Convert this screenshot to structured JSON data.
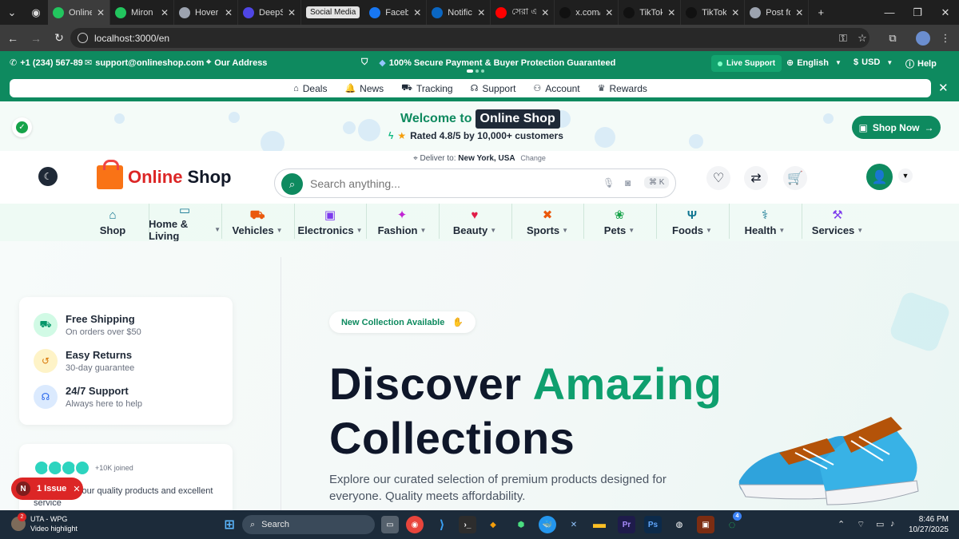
{
  "browser": {
    "tabs": [
      {
        "label": "Online",
        "color": "#22c55e",
        "active": true
      },
      {
        "label": "Miron",
        "color": "#22c55e"
      },
      {
        "label": "Hover",
        "color": "#9ca3af"
      },
      {
        "label": "DeepS",
        "color": "#4f46e5"
      },
      {
        "label": "Faceb",
        "color": "#1877f2"
      },
      {
        "label": "Notific",
        "color": "#0a66c2"
      },
      {
        "label": "সেরা এ",
        "color": "#ff0000"
      },
      {
        "label": "x.com/",
        "color": "#111111"
      },
      {
        "label": "TikTok",
        "color": "#111111"
      },
      {
        "label": "TikTok",
        "color": "#111111"
      },
      {
        "label": "Post fo",
        "color": "#9ca3af"
      }
    ],
    "tab_group": "Social Media",
    "url": "localhost:3000/en"
  },
  "topbar": {
    "phone": "+1 (234) 567-89",
    "email": "support@onlineshop.com",
    "address": "Our Address",
    "secure_msg": "100% Secure Payment & Buyer Protection Guaranteed",
    "live_support": "Live Support",
    "language": "English",
    "currency": "USD",
    "help": "Help"
  },
  "quicklinks": [
    "Deals",
    "News",
    "Tracking",
    "Support",
    "Account",
    "Rewards"
  ],
  "welcome": {
    "prefix": "Welcome to",
    "brand": "Online Shop",
    "rated": "Rated 4.8/5 by 10,000+ customers",
    "shop_now": "Shop Now"
  },
  "header": {
    "deliver_prefix": "Deliver to:",
    "deliver_location": "New York, USA",
    "change": "Change",
    "logo_a": "Online",
    "logo_b": "Shop",
    "search_placeholder": "Search anything...",
    "shortcut": "⌘ K"
  },
  "categories": [
    {
      "label": "Shop",
      "icon": "home-icon",
      "glyph": "⌂",
      "color": "#0e7490",
      "chev": false
    },
    {
      "label": "Home & Living",
      "icon": "sofa-icon",
      "glyph": "▭",
      "color": "#0e7490",
      "chev": true
    },
    {
      "label": "Vehicles",
      "icon": "car-icon",
      "glyph": "⛟",
      "color": "#ea580c",
      "chev": true
    },
    {
      "label": "Electronics",
      "icon": "monitor-icon",
      "glyph": "▣",
      "color": "#7c3aed",
      "chev": true
    },
    {
      "label": "Fashion",
      "icon": "sparkle-icon",
      "glyph": "✦",
      "color": "#c026d3",
      "chev": true
    },
    {
      "label": "Beauty",
      "icon": "heart-pulse-icon",
      "glyph": "♥",
      "color": "#e11d48",
      "chev": true
    },
    {
      "label": "Sports",
      "icon": "dumbbell-icon",
      "glyph": "✖",
      "color": "#ea580c",
      "chev": true
    },
    {
      "label": "Pets",
      "icon": "paw-icon",
      "glyph": "❀",
      "color": "#16a34a",
      "chev": true
    },
    {
      "label": "Foods",
      "icon": "utensils-icon",
      "glyph": "Ψ",
      "color": "#0e7490",
      "chev": true
    },
    {
      "label": "Health",
      "icon": "stethoscope-icon",
      "glyph": "⚕",
      "color": "#0e7490",
      "chev": true
    },
    {
      "label": "Services",
      "icon": "hammer-icon",
      "glyph": "⚒",
      "color": "#7c3aed",
      "chev": true
    }
  ],
  "features": [
    {
      "title": "Free Shipping",
      "sub": "On orders over $50",
      "bg": "#d1fae5",
      "fg": "#059669",
      "glyph": "⛟"
    },
    {
      "title": "Easy Returns",
      "sub": "30-day guarantee",
      "bg": "#fef3c7",
      "fg": "#d97706",
      "glyph": "↺"
    },
    {
      "title": "24/7 Support",
      "sub": "Always here to help",
      "bg": "#dbeafe",
      "fg": "#2563eb",
      "glyph": "☊"
    }
  ],
  "social_proof": {
    "joined": "+10K joined",
    "trust_highlight": "omers",
    "trust_text": " trust our quality products and excellent service"
  },
  "hero": {
    "badge": "New Collection Available",
    "title_a": "Discover",
    "title_b": "Amazing",
    "title_c": "Collections",
    "subtitle": "Explore our curated selection of premium products designed for everyone. Quality meets affordability."
  },
  "devtools_badge": {
    "letter": "N",
    "label": "1 Issue"
  },
  "taskbar": {
    "news_a": "UTA - WPG",
    "news_b": "Video highlight",
    "news_badge": "2",
    "search": "Search",
    "time": "8:46 PM",
    "date": "10/27/2025",
    "whatsapp_badge": "4"
  },
  "colors": {
    "brand": "#0e8a5f",
    "accent": "#0e9f6e"
  }
}
